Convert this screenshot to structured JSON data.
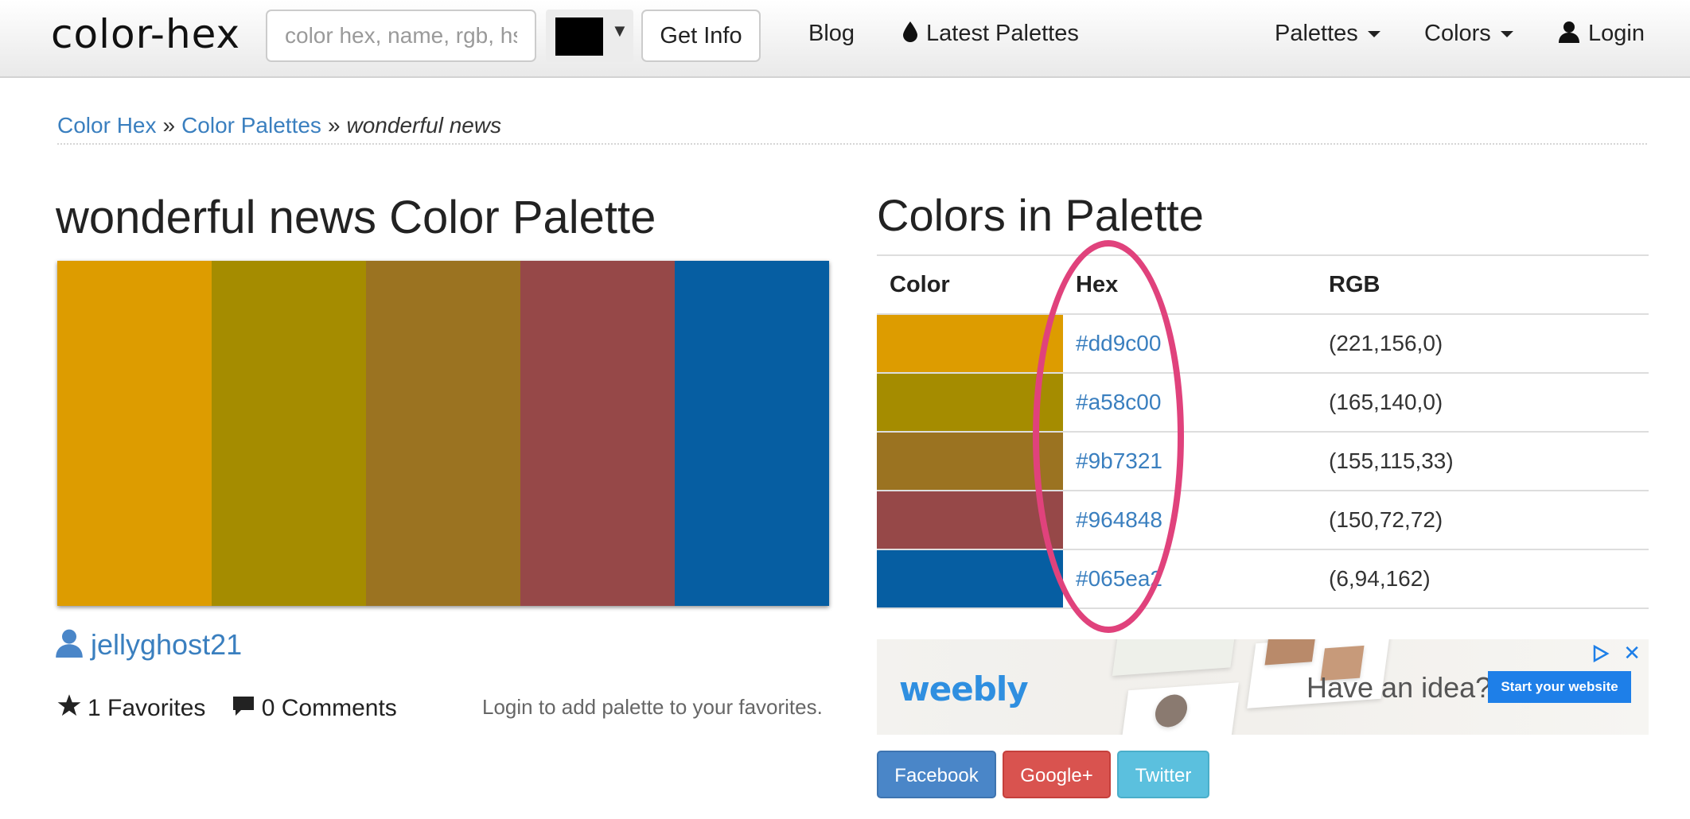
{
  "header": {
    "logo": "color-hex",
    "search_placeholder": "color hex, name, rgb, hsl",
    "color_picker_value": "#000000",
    "get_info_label": "Get Info",
    "blog_label": "Blog",
    "latest_palettes_label": "Latest Palettes",
    "palettes_menu_label": "Palettes",
    "colors_menu_label": "Colors",
    "login_label": "Login"
  },
  "breadcrumb": {
    "home": "Color Hex",
    "sep1": "»",
    "palettes": "Color Palettes",
    "sep2": "»",
    "current": "wonderful news"
  },
  "palette": {
    "title": "wonderful news Color Palette",
    "colors": [
      "#dd9c00",
      "#a58c00",
      "#9b7321",
      "#964848",
      "#065ea2"
    ],
    "author": "jellyghost21",
    "favorites": "1 Favorites",
    "comments": "0 Comments",
    "login_note": "Login to add palette to your favorites."
  },
  "colors_table": {
    "title": "Colors in Palette",
    "headers": [
      "Color",
      "Hex",
      "RGB"
    ],
    "rows": [
      {
        "swatch": "#dd9c00",
        "hex": "#dd9c00",
        "rgb": "(221,156,0)"
      },
      {
        "swatch": "#a58c00",
        "hex": "#a58c00",
        "rgb": "(165,140,0)"
      },
      {
        "swatch": "#9b7321",
        "hex": "#9b7321",
        "rgb": "(155,115,33)"
      },
      {
        "swatch": "#964848",
        "hex": "#964848",
        "rgb": "(150,72,72)"
      },
      {
        "swatch": "#065ea2",
        "hex": "#065ea2",
        "rgb": "(6,94,162)"
      }
    ]
  },
  "ad": {
    "brand": "weebly",
    "headline": "Have an idea?",
    "cta": "Start your website"
  },
  "share": {
    "facebook": "Facebook",
    "google": "Google+",
    "twitter": "Twitter"
  },
  "colors": {
    "link": "#3a7fbf",
    "highlight": "#e0427c",
    "facebook": "#4a86c8",
    "google": "#d9534f",
    "twitter": "#5bc0de"
  }
}
